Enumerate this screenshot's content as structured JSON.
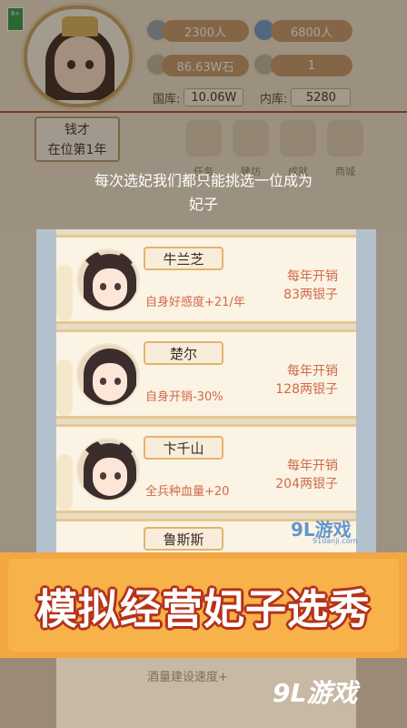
{
  "age_rating": "8+",
  "stats": {
    "population_1": "2300人",
    "population_2": "6800人",
    "grain": "86.63W石",
    "grain_count": "1",
    "treasury_label": "国库:",
    "treasury_value": "10.06W",
    "inner_label": "内库:",
    "inner_value": "5280"
  },
  "ruler": {
    "name": "钱才",
    "reign": "在位第1年"
  },
  "menu": [
    {
      "label": "任务",
      "icon": "task-icon"
    },
    {
      "label": "赌坊",
      "icon": "gamble-icon"
    },
    {
      "label": "成就",
      "icon": "achievement-icon"
    },
    {
      "label": "商城",
      "icon": "shop-icon"
    }
  ],
  "hint": {
    "line1": "每次选妃我们都只能挑选一位成为",
    "line2": "妃子"
  },
  "candidates": [
    {
      "name": "牛兰芝",
      "ability": "自身好感度+21/年",
      "cost_label": "每年开销",
      "cost_value": "83两银子"
    },
    {
      "name": "楚尔",
      "ability": "自身开销-30%",
      "cost_label": "每年开销",
      "cost_value": "128两银子"
    },
    {
      "name": "卞千山",
      "ability": "全兵种血量+20",
      "cost_label": "每年开销",
      "cost_value": "204两银子"
    },
    {
      "name": "鲁斯斯",
      "ability": "",
      "cost_label": "",
      "cost_value": ""
    }
  ],
  "watermark": {
    "brand": "9L游戏",
    "url": "91danji.com"
  },
  "promo": {
    "text": "模拟经营妃子选秀"
  },
  "bottom": {
    "partial_text": "酒量建设速度+"
  },
  "site_logo": "9L游戏",
  "colors": {
    "accent_red": "#b64b33",
    "promo_orange": "#f3a743",
    "cost_text": "#d06a4b"
  }
}
